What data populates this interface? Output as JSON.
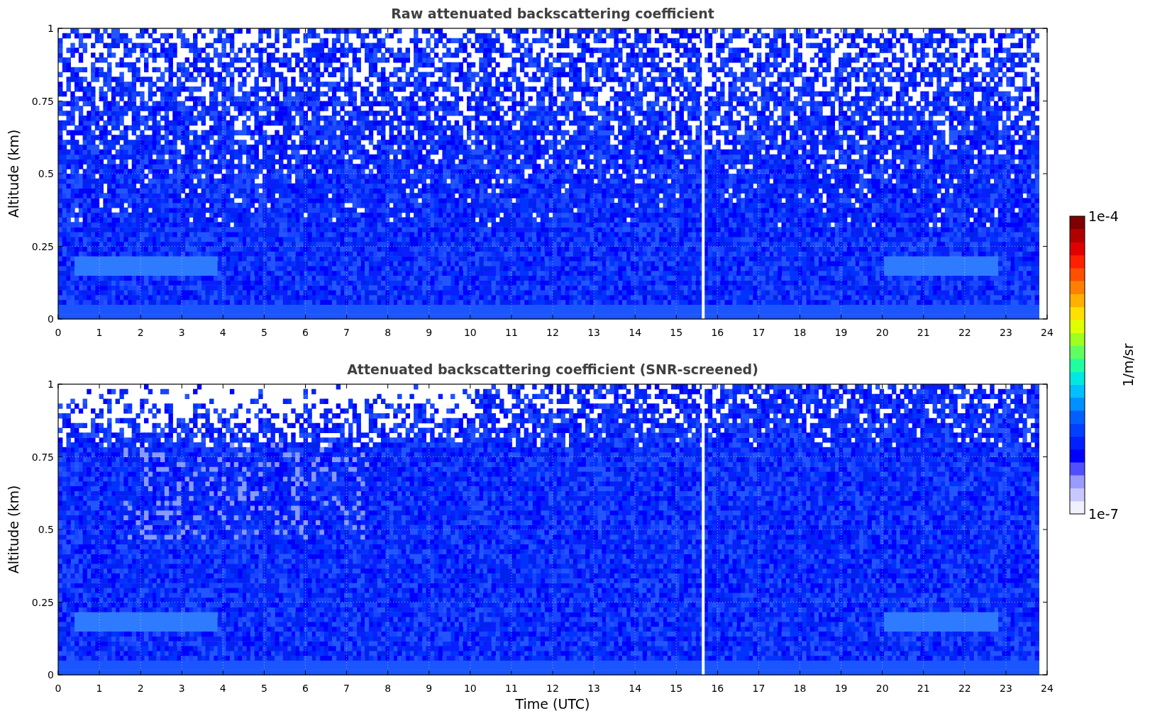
{
  "panels": [
    {
      "kind": "raw",
      "title": "Raw attenuated backscattering coefficient",
      "ylabel": "Altitude (km)",
      "yticks": [
        "1",
        "0.75",
        "0.5",
        "0.25",
        "0"
      ],
      "xticks": [
        "0",
        "1",
        "2",
        "3",
        "4",
        "5",
        "6",
        "7",
        "8",
        "9",
        "10",
        "11",
        "12",
        "13",
        "14",
        "15",
        "16",
        "17",
        "18",
        "19",
        "20",
        "21",
        "22",
        "23",
        "24"
      ]
    },
    {
      "kind": "screened",
      "title": "Attenuated backscattering coefficient (SNR-screened)",
      "ylabel": "Altitude (km)",
      "yticks": [
        "1",
        "0.75",
        "0.5",
        "0.25",
        "0"
      ],
      "xticks": [
        "0",
        "1",
        "2",
        "3",
        "4",
        "5",
        "6",
        "7",
        "8",
        "9",
        "10",
        "11",
        "12",
        "13",
        "14",
        "15",
        "16",
        "17",
        "18",
        "19",
        "20",
        "21",
        "22",
        "23",
        "24"
      ],
      "xlabel": "Time (UTC)"
    }
  ],
  "colorbar": {
    "max_label": "1e-4",
    "min_label": "1e-7",
    "unit": "1/m/sr"
  }
}
